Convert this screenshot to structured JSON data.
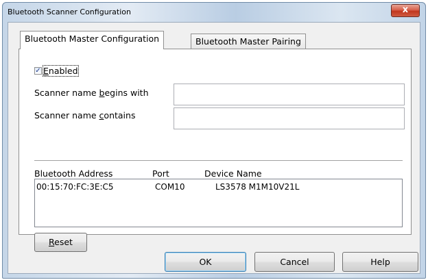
{
  "window": {
    "title": "Bluetooth Scanner Configuration",
    "close_label": "x"
  },
  "tabs": [
    {
      "label": "Bluetooth Master Configuration",
      "active": true
    },
    {
      "label": "Bluetooth Master Pairing",
      "active": false
    }
  ],
  "enabled": {
    "checked": true,
    "mark": "✓",
    "mnemonic": "E",
    "rest": "nabled"
  },
  "name_begins": {
    "label_pre": "Scanner name ",
    "label_mn": "b",
    "label_post": "egins with",
    "value": ""
  },
  "name_contains": {
    "label_pre": "Scanner name ",
    "label_mn": "c",
    "label_post": "ontains",
    "value": ""
  },
  "devices": {
    "columns": [
      "Bluetooth Address",
      "Port",
      "Device Name"
    ],
    "rows": [
      [
        "00:15:70:FC:3E:C5",
        "COM10",
        "LS3578 M1M10V21L"
      ]
    ]
  },
  "reset": {
    "mnemonic": "R",
    "rest": "eset"
  },
  "footer": {
    "ok": "OK",
    "cancel": "Cancel",
    "help": "Help"
  }
}
